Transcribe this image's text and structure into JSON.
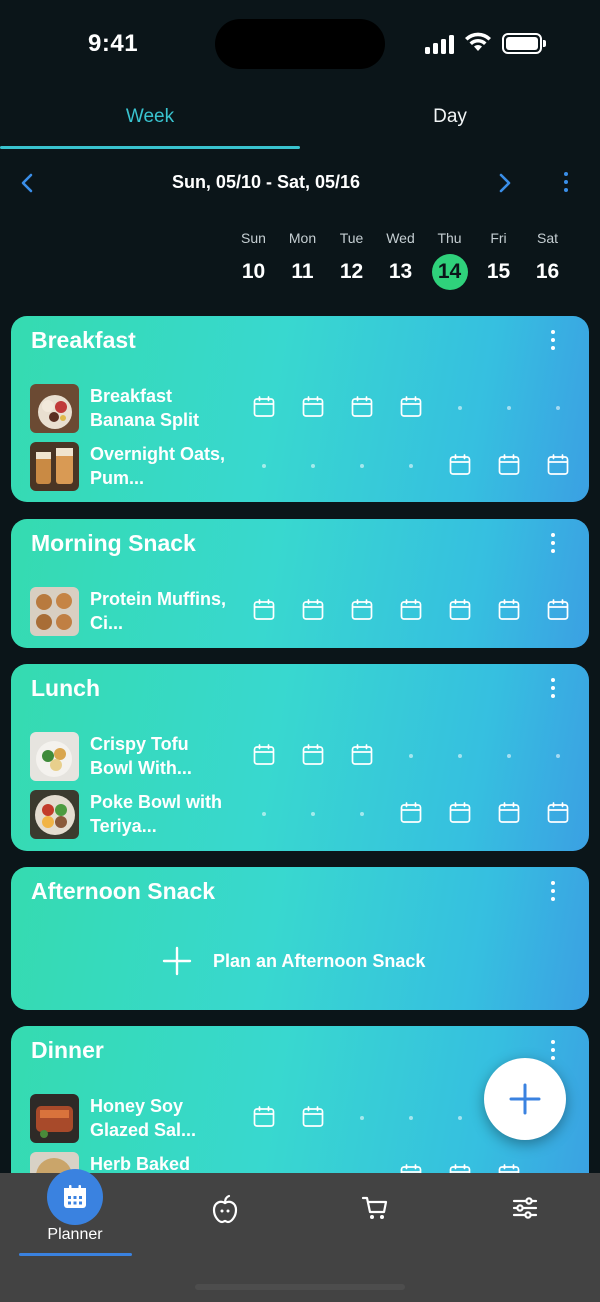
{
  "status_bar": {
    "time": "9:41"
  },
  "tabs": [
    {
      "label": "Week",
      "active": true
    },
    {
      "label": "Day",
      "active": false
    }
  ],
  "date_nav": {
    "range": "Sun, 05/10 - Sat, 05/16"
  },
  "days": [
    {
      "name": "Sun",
      "num": "10"
    },
    {
      "name": "Mon",
      "num": "11"
    },
    {
      "name": "Tue",
      "num": "12"
    },
    {
      "name": "Wed",
      "num": "13"
    },
    {
      "name": "Thu",
      "num": "14",
      "today": true
    },
    {
      "name": "Fri",
      "num": "15"
    },
    {
      "name": "Sat",
      "num": "16"
    }
  ],
  "meals": {
    "breakfast": {
      "title": "Breakfast",
      "recipes": [
        {
          "name": "Breakfast Banana Split",
          "planned": [
            true,
            true,
            true,
            true,
            false,
            false,
            false
          ]
        },
        {
          "name": "Overnight Oats, Pum...",
          "planned": [
            false,
            false,
            false,
            false,
            true,
            true,
            true
          ]
        }
      ]
    },
    "morning_snack": {
      "title": "Morning Snack",
      "recipes": [
        {
          "name": "Protein Muffins, Ci...",
          "planned": [
            true,
            true,
            true,
            true,
            true,
            true,
            true
          ]
        }
      ]
    },
    "lunch": {
      "title": "Lunch",
      "recipes": [
        {
          "name": "Crispy Tofu Bowl With...",
          "planned": [
            true,
            true,
            true,
            false,
            false,
            false,
            false
          ]
        },
        {
          "name": "Poke Bowl with Teriya...",
          "planned": [
            false,
            false,
            false,
            true,
            true,
            true,
            true
          ]
        }
      ]
    },
    "afternoon_snack": {
      "title": "Afternoon Snack",
      "plan_label": "Plan an Afternoon Snack"
    },
    "dinner": {
      "title": "Dinner",
      "recipes": [
        {
          "name": "Honey Soy Glazed Sal...",
          "planned": [
            true,
            true,
            false,
            false,
            false,
            false,
            false
          ]
        },
        {
          "name": "Herb Baked",
          "planned": [
            false,
            false,
            false,
            true,
            true,
            true,
            false
          ]
        }
      ]
    }
  },
  "bottom_nav": [
    {
      "label": "Planner",
      "icon": "calendar-icon",
      "active": true
    },
    {
      "label": "",
      "icon": "apple-icon"
    },
    {
      "label": "",
      "icon": "cart-icon"
    },
    {
      "label": "",
      "icon": "sliders-icon"
    }
  ],
  "colors": {
    "background": "#0b1519",
    "accent_teal": "#39c3cf",
    "today_green": "#2fd17b",
    "nav_blue": "#3a82e0",
    "nav_bar": "#434343"
  }
}
